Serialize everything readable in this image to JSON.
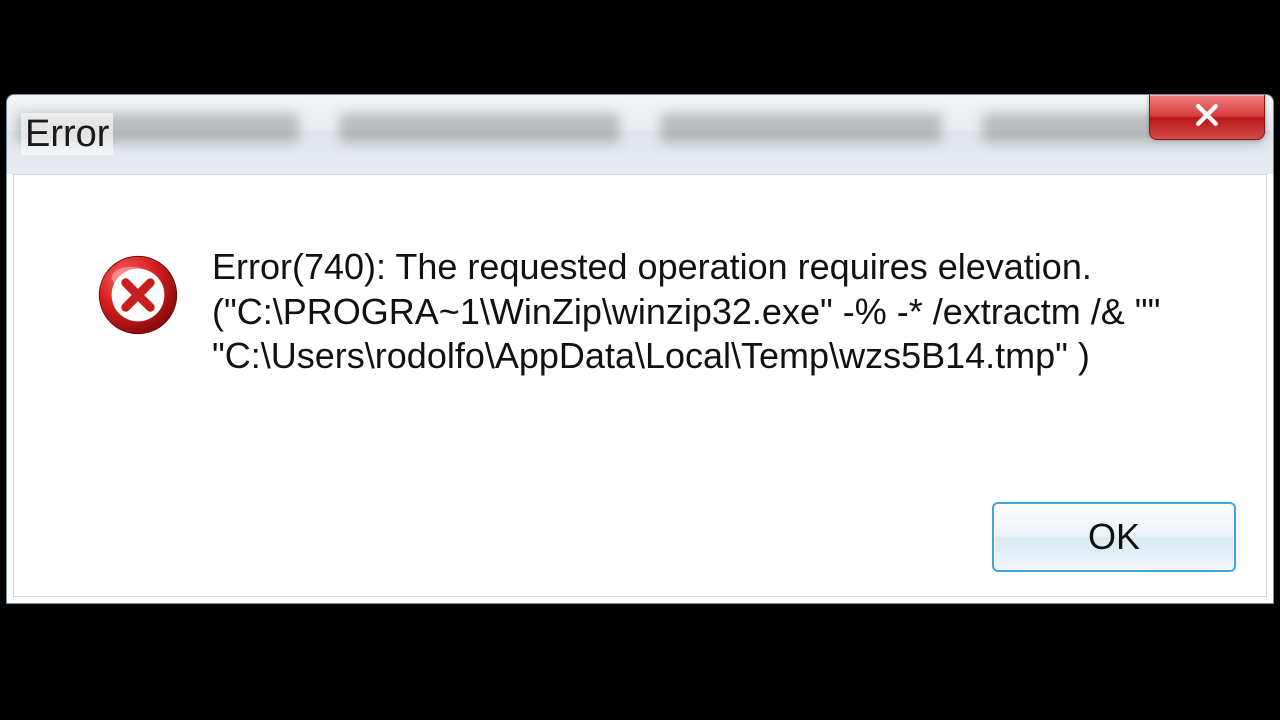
{
  "dialog": {
    "title": "Error",
    "message": "Error(740): The requested operation requires elevation.\n(\"C:\\PROGRA~1\\WinZip\\winzip32.exe\" -% -* /extractm /& \"\"\n\"C:\\Users\\rodolfo\\AppData\\Local\\Temp\\wzs5B14.tmp\" )",
    "ok_label": "OK"
  }
}
